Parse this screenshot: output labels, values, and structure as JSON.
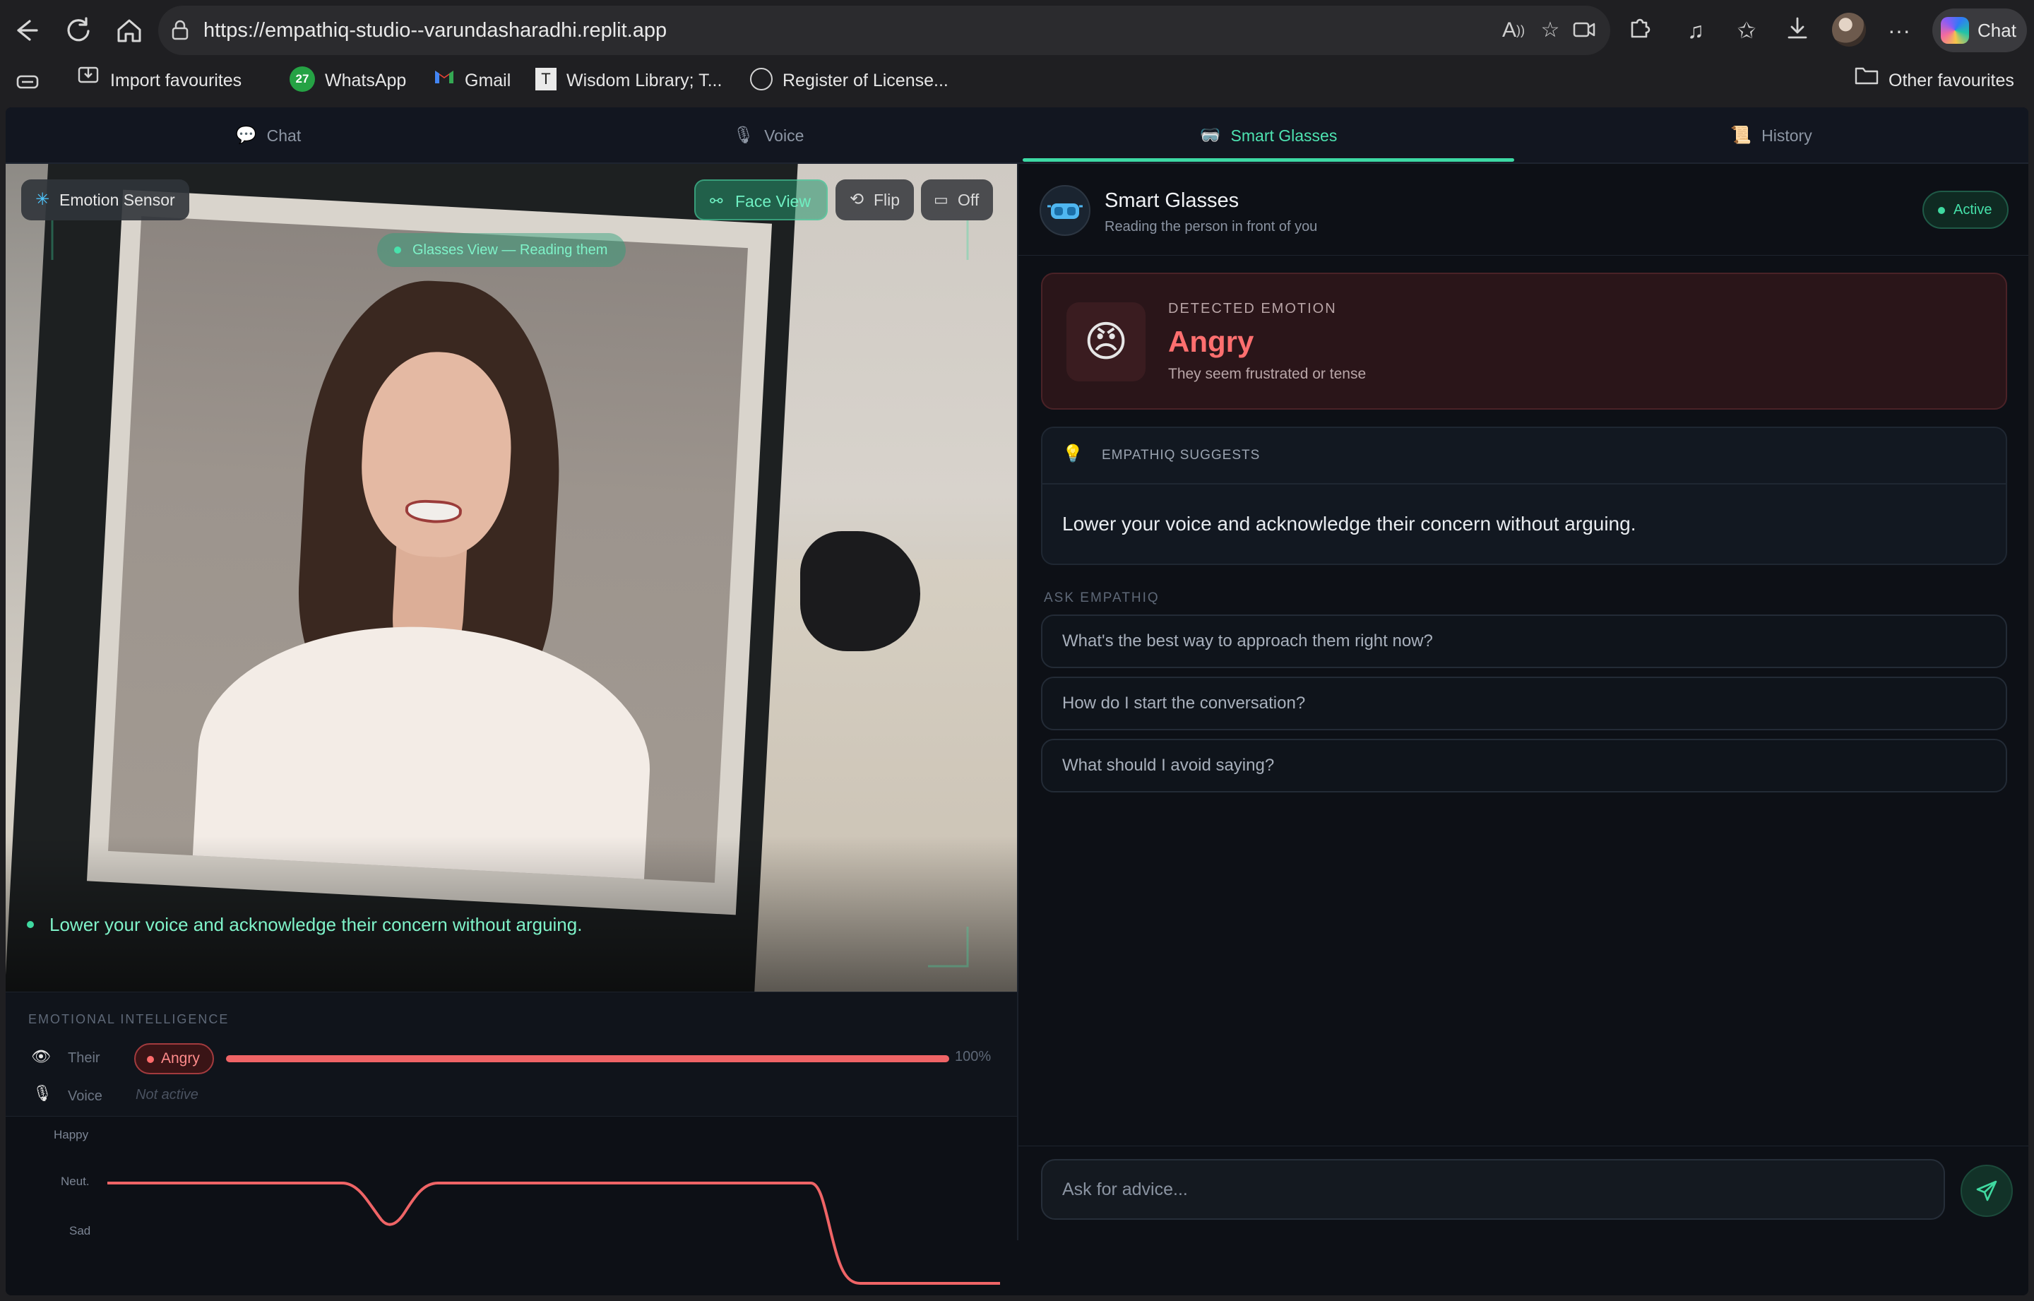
{
  "browser": {
    "url": "https://empathiq-studio--varundasharadhi.replit.app",
    "copilot_label": "Chat",
    "favourites": [
      {
        "label": "Import favourites"
      },
      {
        "label": "WhatsApp",
        "badge": "27"
      },
      {
        "label": "Gmail"
      },
      {
        "label": "Wisdom Library; T..."
      },
      {
        "label": "Register of License..."
      }
    ],
    "other_favourites": "Other favourites",
    "icons": [
      "back-icon",
      "refresh-icon",
      "home-icon",
      "lock-icon",
      "read-aloud-icon",
      "favorite-star-icon",
      "split-screen-icon",
      "extensions-icon",
      "media-icon",
      "favorites-icon",
      "downloads-icon",
      "more-icon"
    ]
  },
  "tabs": [
    {
      "label": "Chat",
      "icon": "speech-bubble-icon"
    },
    {
      "label": "Voice",
      "icon": "microphone-icon"
    },
    {
      "label": "Smart Glasses",
      "icon": "goggles-icon",
      "active": true
    },
    {
      "label": "History",
      "icon": "scroll-icon"
    }
  ],
  "camera": {
    "emotion_sensor": "Emotion Sensor",
    "face_view": "Face View",
    "flip": "Flip",
    "off": "Off",
    "glasses_view": "Glasses View — Reading them",
    "caption": "Lower your voice and acknowledge their concern without arguing."
  },
  "ei": {
    "title": "EMOTIONAL INTELLIGENCE",
    "their_label": "Their",
    "their_emotion": "Angry",
    "their_percent_text": "100%",
    "their_level": 1.0,
    "voice_label": "Voice",
    "voice_status": "Not active"
  },
  "timeline": {
    "labels": [
      "Happy",
      "Neut.",
      "Sad"
    ]
  },
  "colors": {
    "accent": "#3dd9a4",
    "angry": "#ef6466",
    "background": "#0d1016"
  },
  "panel": {
    "title": "Smart Glasses",
    "subtitle": "Reading the person in front of you",
    "status": "Active",
    "detected_label": "DETECTED EMOTION",
    "detected_emoji": "😠",
    "detected_emotion": "Angry",
    "detected_desc": "They seem frustrated or tense",
    "suggests_label": "EMPATHIQ SUGGESTS",
    "suggestion": "Lower your voice and acknowledge their concern without arguing.",
    "ask_label": "ASK EMPATHIQ",
    "questions": [
      "What's the best way to approach them right now?",
      "How do I start the conversation?",
      "What should I avoid saying?"
    ],
    "input_placeholder": "Ask for advice..."
  }
}
